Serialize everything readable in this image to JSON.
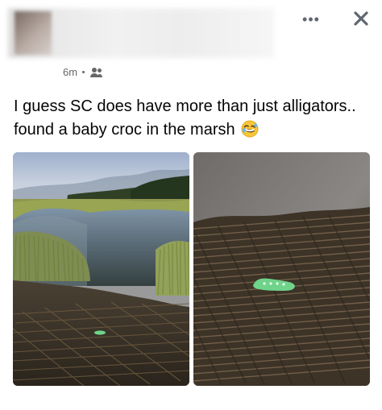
{
  "post": {
    "timestamp": "6m",
    "audience_icon": "friends-icon",
    "text_line1": "I guess SC does have more than just alligators..",
    "text_line2": "found a baby croc in the marsh",
    "emoji": "rolling-on-floor-laughing-emoji"
  },
  "actions": {
    "more_icon": "more-icon",
    "close_icon": "close-icon"
  },
  "photos": [
    {
      "name": "marsh-photo",
      "icon": "photo"
    },
    {
      "name": "croc-closeup-photo",
      "icon": "photo"
    }
  ],
  "colors": {
    "text": "#050505",
    "secondary_text": "#65676b",
    "croc_green": "#6fd38a"
  }
}
